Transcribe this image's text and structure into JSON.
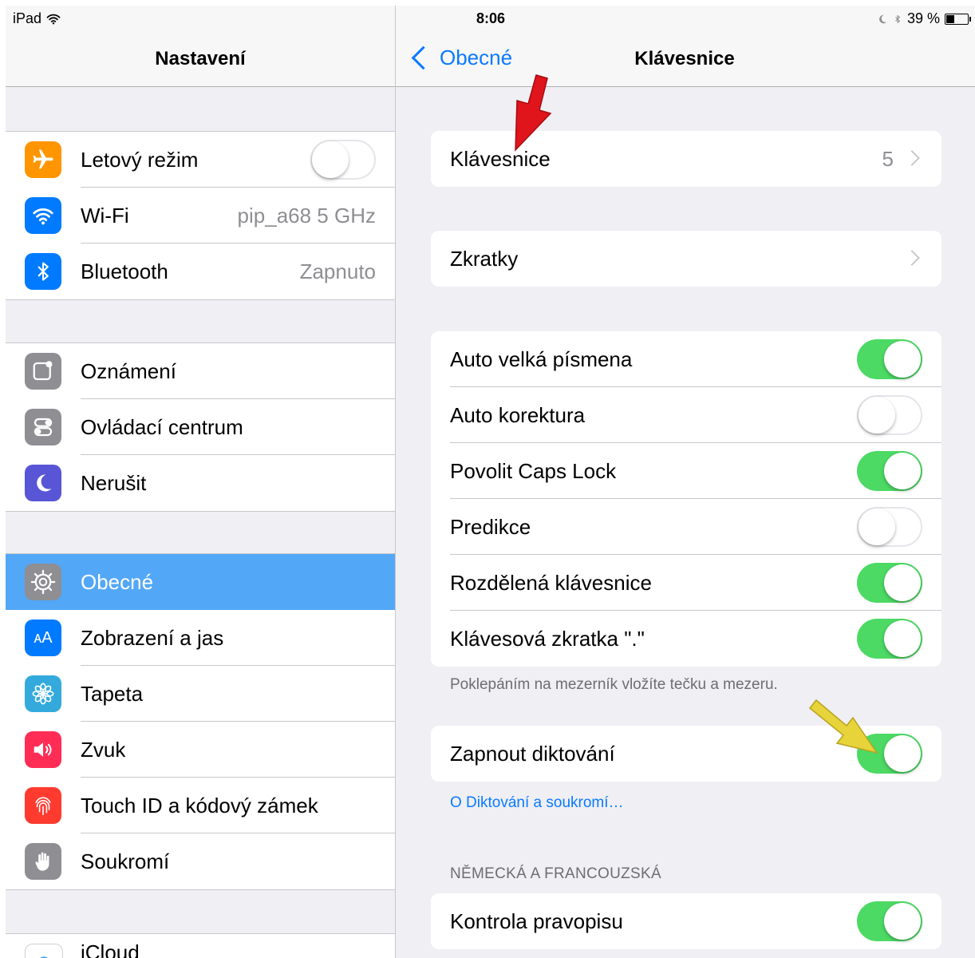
{
  "status_bar": {
    "device": "iPad",
    "time": "8:06",
    "battery": "39 %",
    "battery_level": 0.39
  },
  "sidebar": {
    "title": "Nastavení",
    "groups": [
      [
        {
          "label": "Letový režim",
          "icon": "airplane-icon",
          "color": "#ff9500",
          "toggle": false
        },
        {
          "label": "Wi-Fi",
          "icon": "wifi-icon",
          "color": "#007aff",
          "value": "pip_a68 5 GHz"
        },
        {
          "label": "Bluetooth",
          "icon": "bluetooth-icon",
          "color": "#007aff",
          "value": "Zapnuto"
        }
      ],
      [
        {
          "label": "Oznámení",
          "icon": "notifications-icon",
          "color": "#8e8e93"
        },
        {
          "label": "Ovládací centrum",
          "icon": "control-center-icon",
          "color": "#8e8e93"
        },
        {
          "label": "Nerušit",
          "icon": "moon-icon",
          "color": "#5856d6"
        }
      ],
      [
        {
          "label": "Obecné",
          "icon": "gear-icon",
          "color": "#8e8e93",
          "selected": true
        },
        {
          "label": "Zobrazení a jas",
          "icon": "display-icon",
          "color": "#007aff"
        },
        {
          "label": "Tapeta",
          "icon": "wallpaper-icon",
          "color": "#34aadc"
        },
        {
          "label": "Zvuk",
          "icon": "sound-icon",
          "color": "#ff2d55"
        },
        {
          "label": "Touch ID a kódový zámek",
          "icon": "fingerprint-icon",
          "color": "#ff3b30"
        },
        {
          "label": "Soukromí",
          "icon": "hand-icon",
          "color": "#8e8e93"
        }
      ],
      [
        {
          "label": "iCloud",
          "icon": "cloud-icon",
          "color": "#ffffff"
        }
      ]
    ]
  },
  "detail": {
    "back_label": "Obecné",
    "title": "Klávesnice",
    "keyboards": {
      "label": "Klávesnice",
      "value": "5"
    },
    "shortcuts": {
      "label": "Zkratky"
    },
    "toggles": [
      {
        "label": "Auto velká písmena",
        "on": true
      },
      {
        "label": "Auto korektura",
        "on": false
      },
      {
        "label": "Povolit Caps Lock",
        "on": true
      },
      {
        "label": "Predikce",
        "on": false
      },
      {
        "label": "Rozdělená klávesnice",
        "on": true
      },
      {
        "label": "Klávesová zkratka \".\"",
        "on": true
      }
    ],
    "toggles_footnote": "Poklepáním na mezerník vložíte tečku a mezeru.",
    "dictation": {
      "label": "Zapnout diktování",
      "on": true
    },
    "dictation_link": "O Diktování a soukromí…",
    "section_header": "NĚMECKÁ A FRANCOUZSKÁ",
    "spellcheck": {
      "label": "Kontrola pravopisu",
      "on": true
    }
  }
}
